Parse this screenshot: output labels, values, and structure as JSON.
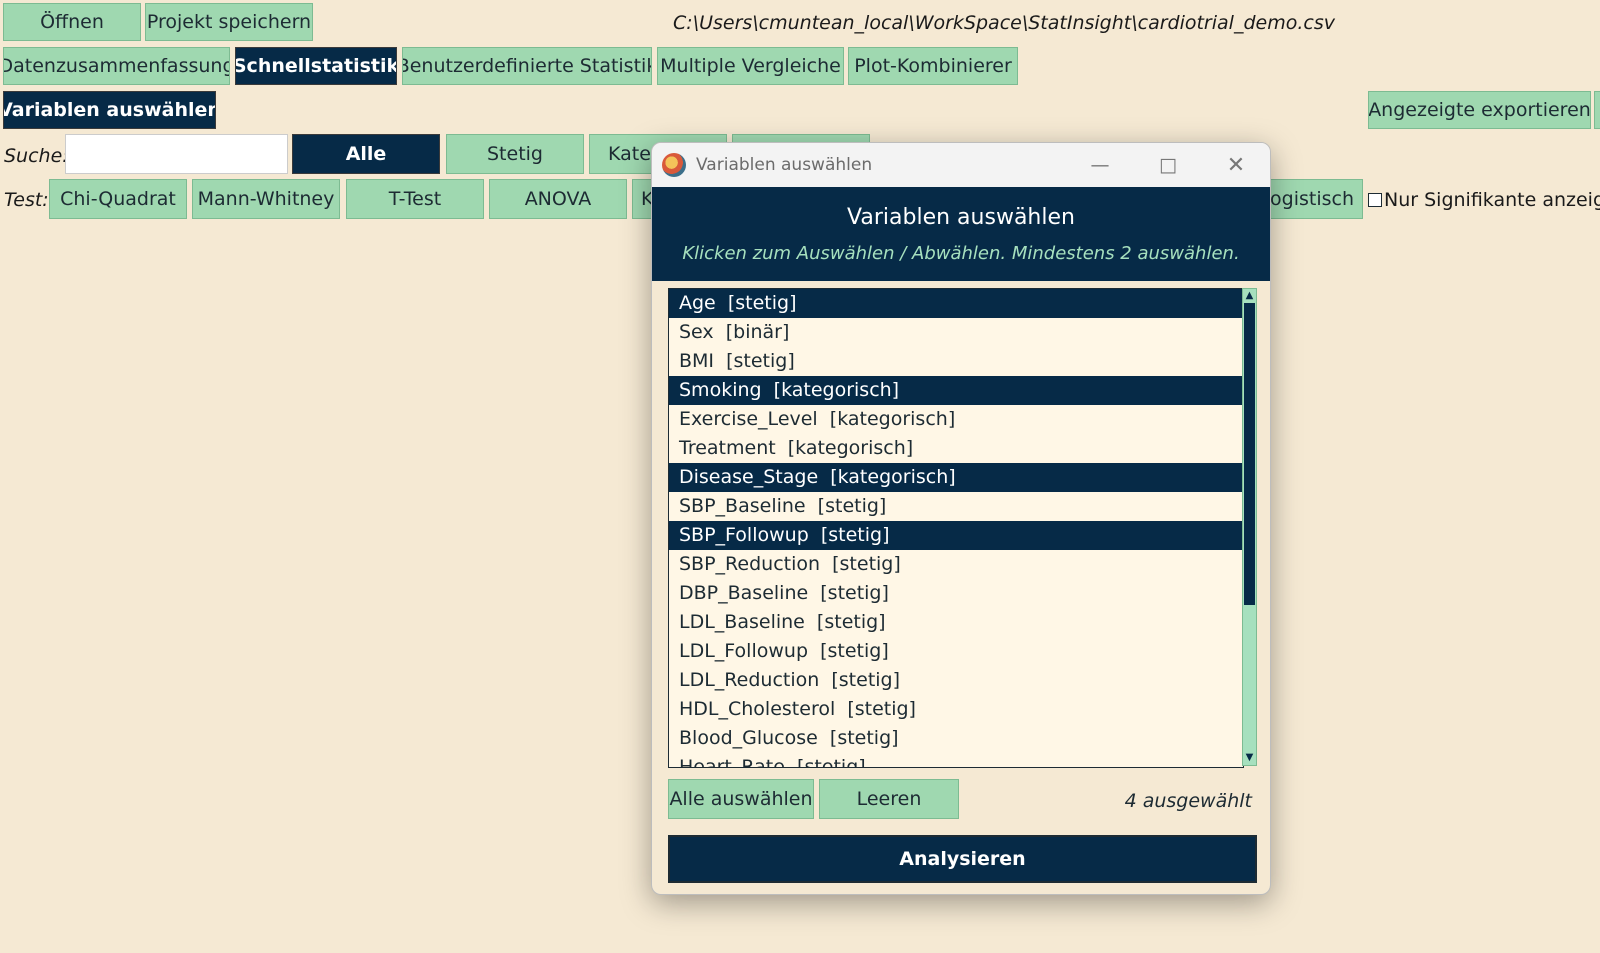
{
  "toolbar": {
    "open": "Öffnen",
    "save_project": "Projekt speichern"
  },
  "filepath": "C:\\Users\\cmuntean_local\\WorkSpace\\StatInsight\\cardiotrial_demo.csv",
  "tabs": [
    "Datenzusammenfassung",
    "Schnellstatistik",
    "Benutzerdefinierte Statistik",
    "Multiple Vergleiche",
    "Plot-Kombinierer"
  ],
  "active_tab": "Schnellstatistik",
  "select_vars_button": "Variablen auswählen",
  "export_button": "Angezeigte exportieren",
  "search": {
    "label": "Suche:",
    "value": ""
  },
  "filters": [
    "Alle",
    "Stetig",
    "Kateg",
    ""
  ],
  "test": {
    "label": "Test:",
    "buttons": [
      "Chi-Quadrat",
      "Mann-Whitney",
      "T-Test",
      "ANOVA",
      "K"
    ],
    "logistic": "Logistisch"
  },
  "only_significant": "Nur Signifikante anzeiger",
  "dialog": {
    "window_title": "Variablen auswählen",
    "heading": "Variablen auswählen",
    "subheading": "Klicken zum Auswählen / Abwählen. Mindestens 2 auswählen.",
    "items": [
      {
        "label": "Age  [stetig]",
        "selected": true
      },
      {
        "label": "Sex  [binär]",
        "selected": false
      },
      {
        "label": "BMI  [stetig]",
        "selected": false
      },
      {
        "label": "Smoking  [kategorisch]",
        "selected": true
      },
      {
        "label": "Exercise_Level  [kategorisch]",
        "selected": false
      },
      {
        "label": "Treatment  [kategorisch]",
        "selected": false
      },
      {
        "label": "Disease_Stage  [kategorisch]",
        "selected": true
      },
      {
        "label": "SBP_Baseline  [stetig]",
        "selected": false
      },
      {
        "label": "SBP_Followup  [stetig]",
        "selected": true
      },
      {
        "label": "SBP_Reduction  [stetig]",
        "selected": false
      },
      {
        "label": "DBP_Baseline  [stetig]",
        "selected": false
      },
      {
        "label": "LDL_Baseline  [stetig]",
        "selected": false
      },
      {
        "label": "LDL_Followup  [stetig]",
        "selected": false
      },
      {
        "label": "LDL_Reduction  [stetig]",
        "selected": false
      },
      {
        "label": "HDL_Cholesterol  [stetig]",
        "selected": false
      },
      {
        "label": "Blood_Glucose  [stetig]",
        "selected": false
      },
      {
        "label": "Heart_Rate  [stetig]",
        "selected": false
      }
    ],
    "select_all": "Alle auswählen",
    "clear": "Leeren",
    "count_text": "4 ausgewählt",
    "analyze": "Analysieren"
  },
  "colors": {
    "background": "#f5e9d3",
    "button": "#9fd8b0",
    "dark": "#062a47",
    "accent_text": "#a6e0be"
  }
}
